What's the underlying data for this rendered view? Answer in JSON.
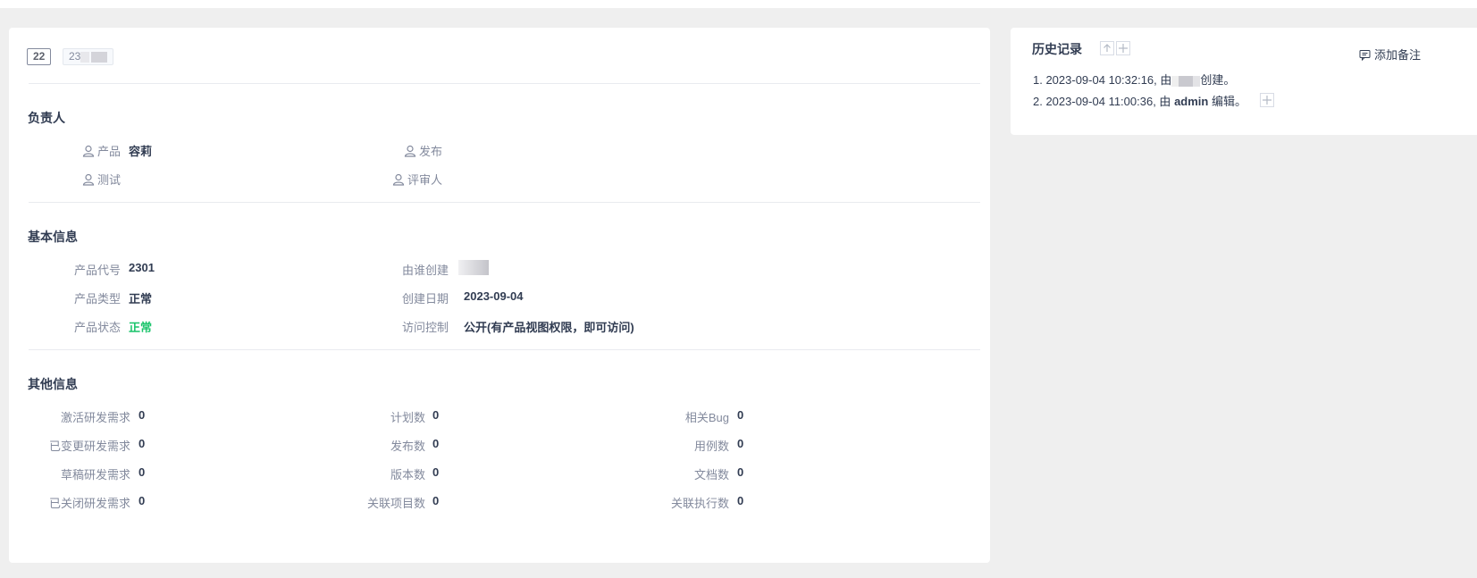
{
  "product": {
    "id": "22",
    "code_prefix": "23"
  },
  "owners": {
    "title": "负责人",
    "items": [
      {
        "label": "产品",
        "value": "容莉"
      },
      {
        "label": "发布",
        "value": ""
      },
      {
        "label": "测试",
        "value": ""
      },
      {
        "label": "评审人",
        "value": ""
      }
    ]
  },
  "basic": {
    "title": "基本信息",
    "code_label": "产品代号",
    "code_value": "2301",
    "type_label": "产品类型",
    "type_value": "正常",
    "status_label": "产品状态",
    "status_value": "正常",
    "creator_label": "由谁创建",
    "date_label": "创建日期",
    "date_value": "2023-09-04",
    "acl_label": "访问控制",
    "acl_value": "公开(有产品视图权限，即可访问)"
  },
  "other": {
    "title": "其他信息",
    "col1": [
      {
        "label": "激活研发需求",
        "value": "0"
      },
      {
        "label": "已变更研发需求",
        "value": "0"
      },
      {
        "label": "草稿研发需求",
        "value": "0"
      },
      {
        "label": "已关闭研发需求",
        "value": "0"
      }
    ],
    "col2": [
      {
        "label": "计划数",
        "value": "0"
      },
      {
        "label": "发布数",
        "value": "0"
      },
      {
        "label": "版本数",
        "value": "0"
      },
      {
        "label": "关联项目数",
        "value": "0"
      }
    ],
    "col3": [
      {
        "label": "相关Bug",
        "value": "0"
      },
      {
        "label": "用例数",
        "value": "0"
      },
      {
        "label": "文档数",
        "value": "0"
      },
      {
        "label": "关联执行数",
        "value": "0"
      }
    ]
  },
  "history": {
    "title": "历史记录",
    "add_note": "添加备注",
    "entry1_prefix": "1. 2023-09-04 10:32:16, 由",
    "entry1_suffix": "创建。",
    "entry2_prefix": "2. 2023-09-04 11:00:36, 由",
    "entry2_user": "admin",
    "entry2_suffix": "编辑。",
    "up_icon": "arrow-up-icon",
    "plus_icon": "plus-icon"
  },
  "colors": {
    "accent_green": "#1bc46b",
    "label_gray": "#838a9d",
    "text_dark": "#313c52"
  }
}
